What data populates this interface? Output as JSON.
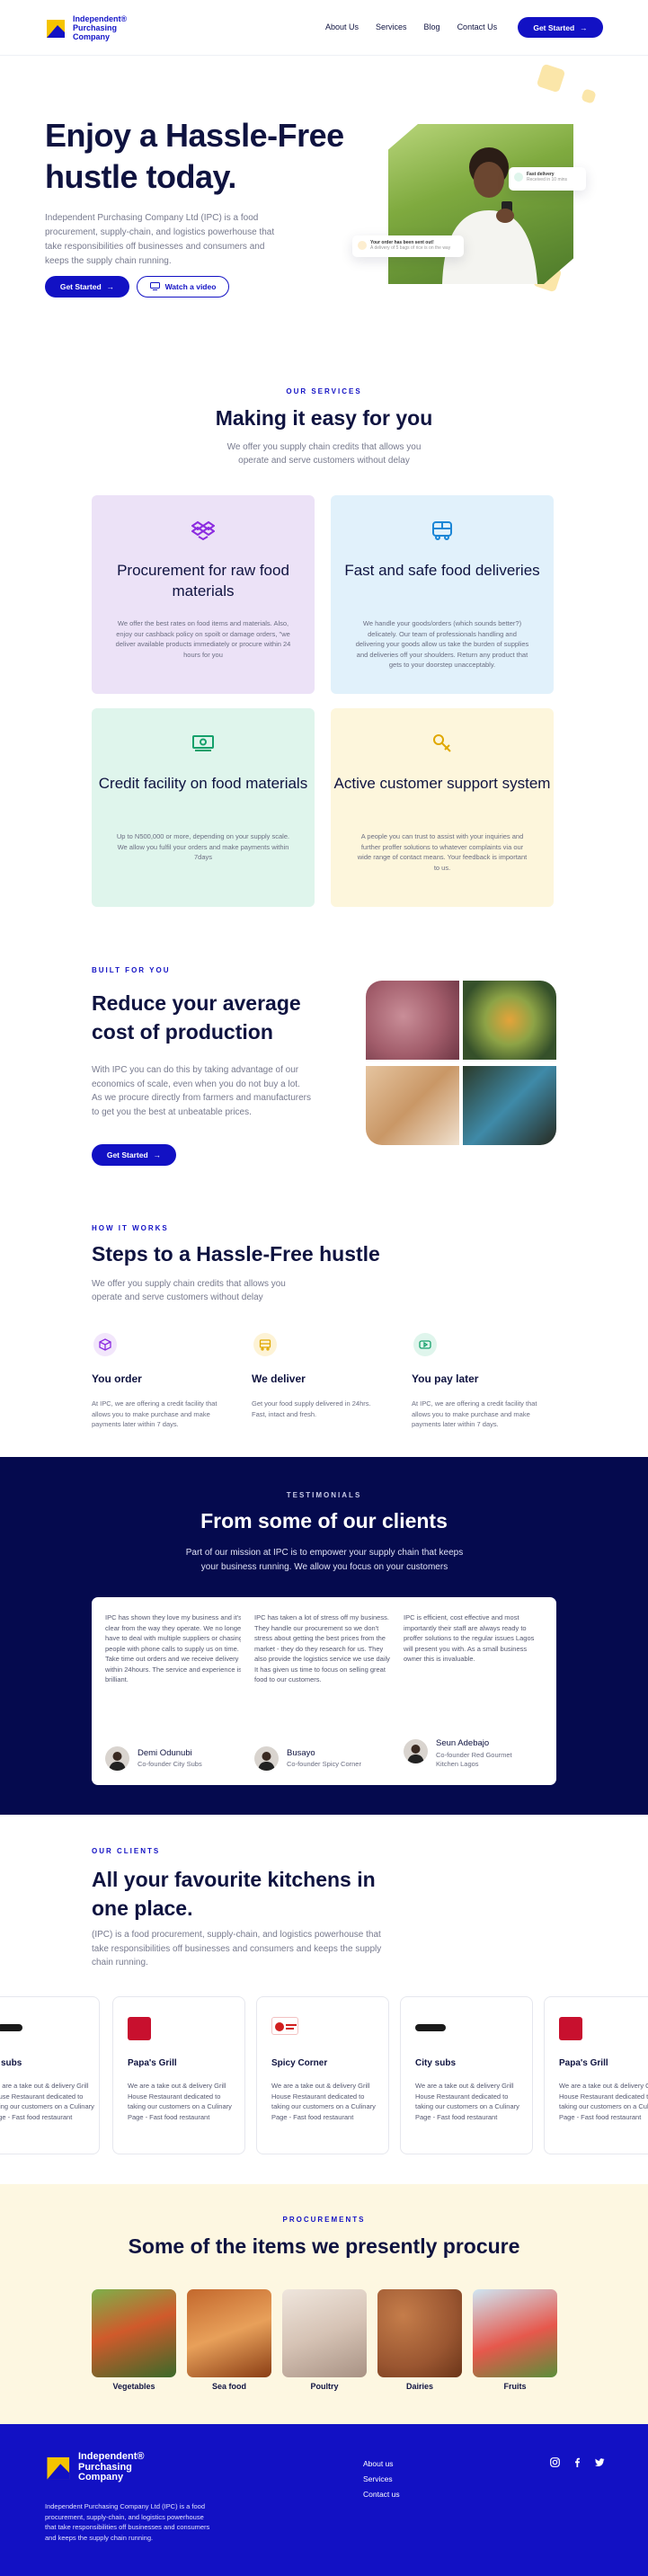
{
  "nav": {
    "brand": "Independent® Purchasing Company",
    "links": [
      "About Us",
      "Services",
      "Blog",
      "Contact Us"
    ],
    "cta": "Get Started"
  },
  "hero": {
    "title": "Enjoy a Hassle-Free hustle today.",
    "subtitle": "Independent Purchasing Company Ltd (IPC) is a food procurement, supply-chain, and logistics powerhouse that take responsibilities off businesses and consumers and keeps the supply chain running.",
    "primary_cta": "Get Started",
    "secondary_cta": "Watch a video",
    "float_card_1": {
      "title": "Fast delivery",
      "sub": "Received in 10 mins"
    },
    "float_card_2": {
      "title": "Your order has been sent out!",
      "sub": "A delivery of 5 bags of rice is on the way"
    }
  },
  "services": {
    "eyebrow": "OUR SERVICES",
    "title": "Making it easy for you",
    "subtitle": "We offer you supply chain credits that allows you operate and serve customers without delay",
    "cards": [
      {
        "title": "Procurement for raw food materials",
        "body": "We offer the best rates on food items and materials. Also, enjoy our cashback policy on spoilt or damage orders, \"we deliver available products immediately or procure within 24 hours for you",
        "bg": "#ece2f7",
        "icon": "dropbox-icon",
        "accent": "#8b2be0"
      },
      {
        "title": "Fast and safe food deliveries",
        "body": "We handle your goods/orders (which sounds better?) delicately. Our team of professionals handling and delivering your goods allow us take the burden of supplies and deliveries off your shoulders. Return any product that gets to your doorstep unacceptably.",
        "bg": "#e1f1fb",
        "icon": "bus-icon",
        "accent": "#1b86d6"
      },
      {
        "title": "Credit facility on food materials",
        "body": "Up to N500,000 or more, depending on your supply scale. We allow you fulfil your orders and make payments within 7days",
        "bg": "#dff5ec",
        "icon": "money-icon",
        "accent": "#15a06b"
      },
      {
        "title": "Active customer support system",
        "body": "A people you can trust to assist with your inquiries and further proffer solutions to whatever complaints via our wide range of contact means. Your feedback is important to us.",
        "bg": "#fdf6dc",
        "icon": "key-icon",
        "accent": "#e0a800"
      }
    ]
  },
  "built": {
    "eyebrow": "BUILT FOR YOU",
    "title": "Reduce your average cost  of production",
    "body": "With IPC you can do this by taking advantage of our economics of scale, even when you do not buy a lot. As we procure directly from farmers and manufacturers to get you the best at unbeatable prices.",
    "cta": "Get Started"
  },
  "steps": {
    "eyebrow": "HOW IT WORKS",
    "title": "Steps to a Hassle-Free hustle",
    "subtitle": "We offer you supply chain credits that allows you operate and serve customers without delay",
    "items": [
      {
        "title": "You order",
        "body": "At IPC, we are offering a credit facility that allows you to make purchase and make payments later within 7 days.",
        "icon": "cube-icon",
        "bg": "#f2e6fb",
        "accent": "#8b2be0"
      },
      {
        "title": "We deliver",
        "body": "Get your food supply delivered in 24hrs. Fast, intact and fresh.",
        "icon": "truck-icon",
        "bg": "#fdf3d6",
        "accent": "#e0a800"
      },
      {
        "title": "You pay later",
        "body": "At IPC, we are offering a credit facility that allows you to make purchase and make payments later within 7 days.",
        "icon": "play-card-icon",
        "bg": "#dff5ec",
        "accent": "#15a06b"
      }
    ]
  },
  "testimonials": {
    "eyebrow": "TESTIMONIALS",
    "title": "From some of our clients",
    "subtitle": "Part of our mission at IPC is to empower your supply chain that keeps your business running. We allow you focus on your customers",
    "items": [
      {
        "text": "IPC has shown they love my business and it's clear from the way they operate. We no longer have to deal with multiple suppliers or chasing people with phone calls to supply us on time. Take time out orders and we receive delivery within 24hours. The service and experience is brilliant.",
        "name": "Demi Odunubi",
        "role": "Co-founder City Subs"
      },
      {
        "text": "IPC has taken a lot of stress off my business. They handle our procurement so we don't stress about getting the best prices from the market - they do they research for us. They also provide the logistics service we use daily. It has given us time to focus on selling great food to our customers.",
        "name": "Busayo",
        "role": "Co-founder Spicy Corner"
      },
      {
        "text": "IPC is efficient, cost effective and most importantly their staff are always ready to proffer solutions to the regular issues Lagos will present you with. As a small business owner this is invaluable.",
        "name": "Seun Adebajo",
        "role": "Co-founder Red Gourmet Kitchen Lagos"
      }
    ]
  },
  "clients": {
    "eyebrow": "OUR CLIENTS",
    "title": "All your favourite kitchens in one place.",
    "subtitle": "(IPC) is a food procurement, supply-chain, and logistics powerhouse that take responsibilities off businesses and consumers and keeps the supply chain running.",
    "items": [
      {
        "name": "subs",
        "body": "We are a take out & delivery Grill House Restaurant dedicated to taking our customers on a Culinary Page - Fast food restaurant"
      },
      {
        "name": "Papa's Grill",
        "body": "We are a take out & delivery Grill House Restaurant dedicated to taking our customers on a Culinary Page - Fast food restaurant"
      },
      {
        "name": "Spicy Corner",
        "body": "We are a take out & delivery Grill House Restaurant dedicated to taking our customers on a Culinary Page - Fast food restaurant"
      },
      {
        "name": "City subs",
        "body": "We are a take out & delivery Grill House Restaurant dedicated to taking our customers on a Culinary Page - Fast food restaurant"
      },
      {
        "name": "Papa's Grill",
        "body": "We are a take out & delivery Grill House Restaurant dedicated to taking our customers on a Culinary Page - Fast food restaurant"
      }
    ]
  },
  "procure": {
    "eyebrow": "PROCUREMENTS",
    "title": "Some of the items we presently procure",
    "items": [
      "Vegetables",
      "Sea food",
      "Poultry",
      "Dairies",
      "Fruits"
    ]
  },
  "footer": {
    "brand": "Independent® Purchasing Company",
    "body": "Independent Purchasing Company Ltd (IPC) is a food procurement, supply-chain, and logistics powerhouse that take responsibilities off businesses and consumers and keeps the supply chain running.",
    "links": [
      "About us",
      "Services",
      "Contact us"
    ],
    "social": [
      "instagram-icon",
      "facebook-icon",
      "twitter-icon"
    ]
  },
  "colors": {
    "brand": "#1211c4",
    "navy": "#050a4e",
    "yellow": "#f5c400"
  }
}
